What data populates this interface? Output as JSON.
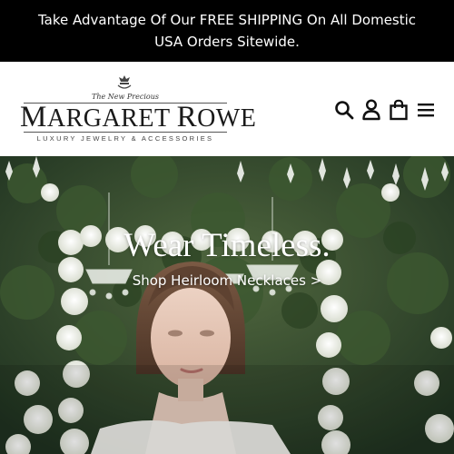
{
  "announcement": {
    "text": "Take Advantage Of Our FREE SHIPPING On All Domestic USA Orders Sitewide."
  },
  "header": {
    "logo": {
      "tagline": "The New Precious",
      "brand_first_initial": "M",
      "brand_first_rest": "ARGARET",
      "brand_last_initial": "R",
      "brand_last_rest": "OWE",
      "subline": "LUXURY JEWELRY & ACCESSORIES"
    },
    "icons": [
      "search-icon",
      "account-icon",
      "cart-icon",
      "menu-icon"
    ]
  },
  "hero": {
    "title": "Wear Timeless.",
    "link_label": "Shop Heirloom Necklaces >"
  },
  "colors": {
    "announcement_bg": "#000000",
    "announcement_text": "#ffffff",
    "hero_text": "#ffffff"
  }
}
